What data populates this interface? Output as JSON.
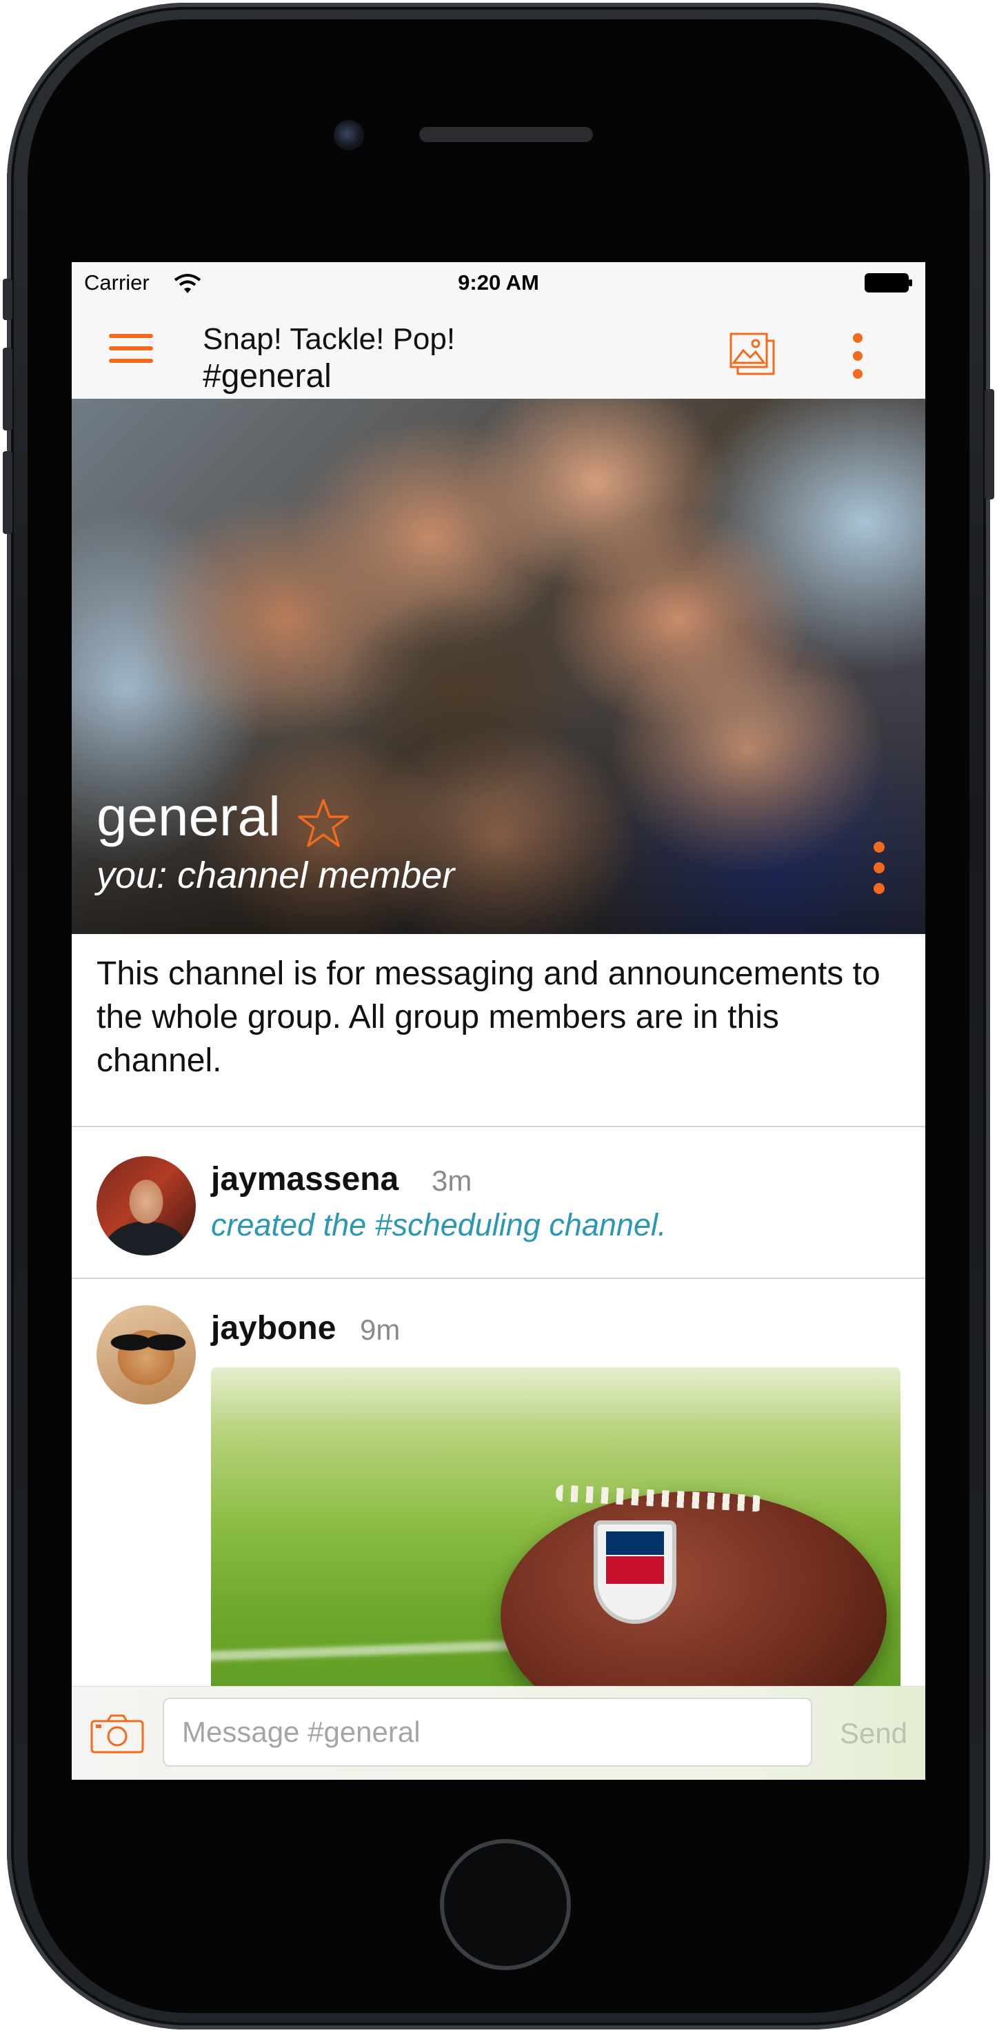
{
  "status_bar": {
    "carrier": "Carrier",
    "time": "9:20 AM"
  },
  "nav": {
    "group_name": "Snap! Tackle! Pop!",
    "channel": "#general"
  },
  "hero": {
    "channel_name": "general",
    "role": "you: channel member"
  },
  "channel_description": "This channel is for messaging and announcements to the whole group. All group members are in this channel.",
  "messages": [
    {
      "author": "jaymassena",
      "time": "3m",
      "event": "created the #scheduling channel."
    },
    {
      "author": "jaybone",
      "time": "9m"
    }
  ],
  "composer": {
    "placeholder": "Message #general",
    "send_label": "Send"
  },
  "colors": {
    "accent": "#f26b1d",
    "link": "#2b97b3",
    "send_disabled": "#b9c3b0"
  },
  "icons": {
    "menu": "hamburger-icon",
    "gallery": "gallery-icon",
    "more": "more-vertical-icon",
    "star": "star-outline-icon",
    "camera": "camera-icon",
    "wifi": "wifi-icon",
    "battery": "battery-icon"
  }
}
